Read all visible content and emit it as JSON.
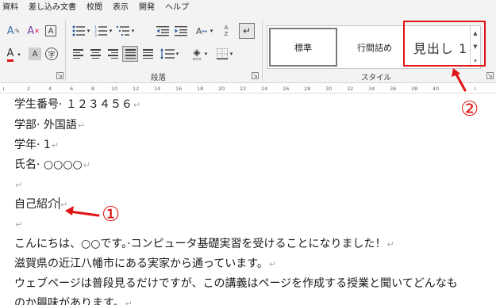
{
  "menu": [
    "資料",
    "差し込み文書",
    "校閲",
    "表示",
    "開発",
    "ヘルプ"
  ],
  "ribbon": {
    "paragraph_group_label": "段落",
    "styles_group_label": "スタイル",
    "styles": [
      {
        "label": "標準",
        "selected": true
      },
      {
        "label": "行間詰め",
        "selected": false
      },
      {
        "label": "見出し 1",
        "selected": false
      }
    ]
  },
  "ruler": [
    "2",
    "4",
    "6",
    "8",
    "10",
    "12",
    "14",
    "16",
    "18",
    "20",
    "22",
    "24",
    "26",
    "28",
    "30",
    "32",
    "34",
    "36",
    "38",
    "40"
  ],
  "document": {
    "lines": [
      {
        "text": "学生番号· １２３４５６"
      },
      {
        "text": "学部· 外国語"
      },
      {
        "text": "学年· 1"
      },
      {
        "text": "氏名· ○○○○"
      },
      {
        "text": ""
      },
      {
        "text": "自己紹介"
      },
      {
        "text": ""
      },
      {
        "text": "こんにちは、○○です。·コンピュータ基礎実習を受けることになりました！"
      },
      {
        "text": "滋賀県の近江八幡市にある実家から通っています。"
      },
      {
        "text": "ウェブページは普段見るだけですが、この講義はページを作成する授業と聞いてどんなも"
      },
      {
        "text": "のか興味があります。"
      }
    ],
    "para_mark": "↵"
  },
  "annotations": {
    "marker_1": "①",
    "marker_2": "②",
    "color": "#e01414"
  }
}
